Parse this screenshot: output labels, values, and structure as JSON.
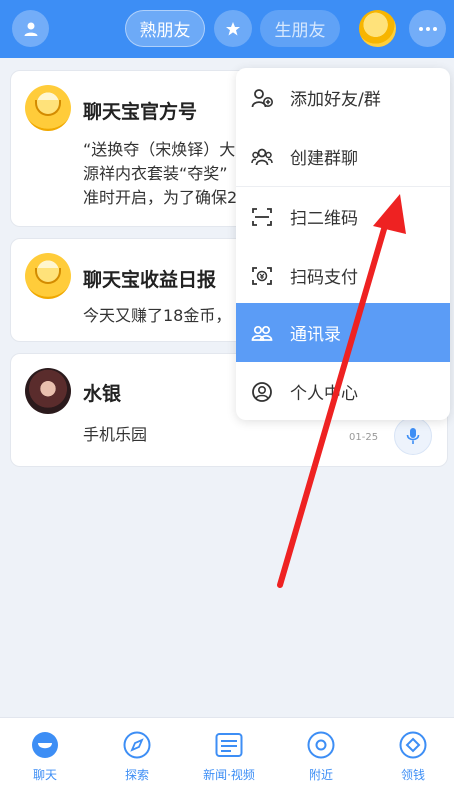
{
  "topbar": {
    "active_tab": "熟朋友",
    "inactive_tab": "生朋友"
  },
  "chats": [
    {
      "title": "聊天宝官方号",
      "lines": [
        "“送换夺（宋焕铎）大",
        "源祥内衣套装“夺奖”",
        "准时开启，为了确保2"
      ]
    },
    {
      "title": "聊天宝收益日报",
      "lines": [
        "今天又赚了18金币，"
      ]
    },
    {
      "title": "水银",
      "lines": [
        "手机乐园"
      ],
      "date": "01-25"
    }
  ],
  "menu": {
    "items": [
      {
        "label": "添加好友/群",
        "icon": "add-friend-icon"
      },
      {
        "label": "创建群聊",
        "icon": "group-icon"
      },
      {
        "label": "扫二维码",
        "icon": "scan-icon"
      },
      {
        "label": "扫码支付",
        "icon": "scan-pay-icon"
      },
      {
        "label": "通讯录",
        "icon": "contacts-icon",
        "highlighted": true
      },
      {
        "label": "个人中心",
        "icon": "profile-icon"
      }
    ]
  },
  "bottom_nav": [
    {
      "label": "聊天",
      "icon": "chat-icon",
      "active": true
    },
    {
      "label": "探索",
      "icon": "compass-icon"
    },
    {
      "label": "新闻·视频",
      "icon": "news-icon"
    },
    {
      "label": "附近",
      "icon": "location-icon"
    },
    {
      "label": "领钱",
      "icon": "diamond-icon"
    }
  ],
  "colors": {
    "brand": "#3d8ef5",
    "menu_highlight": "#5b9cf6",
    "annotation_arrow": "#ee2222"
  }
}
